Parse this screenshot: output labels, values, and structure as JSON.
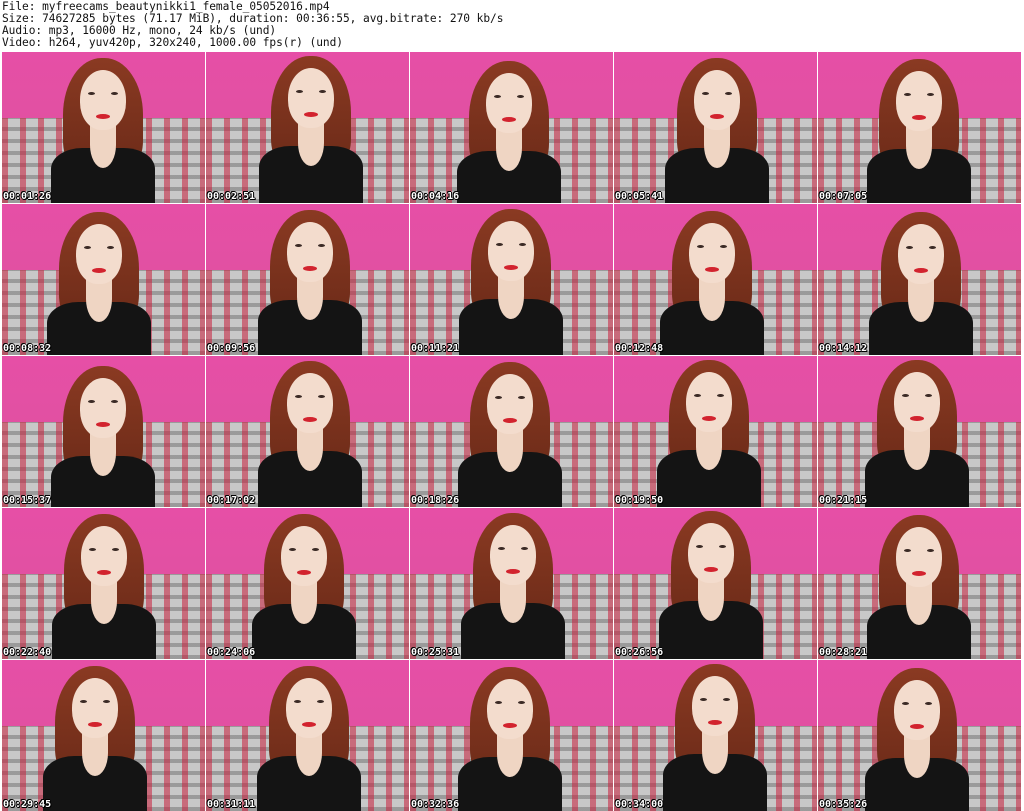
{
  "header": {
    "line1": "File: myfreecams_beautynikki1_female_05052016.mp4",
    "line2": "Size: 74627285 bytes (71.17 MiB), duration: 00:36:55, avg.bitrate: 270 kb/s",
    "line3": "Audio: mp3, 16000 Hz, mono, 24 kb/s (und)",
    "line4": "Video: h264, yuv420p, 320x240, 1000.00 fps(r) (und)"
  },
  "thumbnails": [
    {
      "timestamp": "00:01:26"
    },
    {
      "timestamp": "00:02:51"
    },
    {
      "timestamp": "00:04:16"
    },
    {
      "timestamp": "00:05:41"
    },
    {
      "timestamp": "00:07:05"
    },
    {
      "timestamp": "00:08:32"
    },
    {
      "timestamp": "00:09:56"
    },
    {
      "timestamp": "00:11:21"
    },
    {
      "timestamp": "00:12:48"
    },
    {
      "timestamp": "00:14:12"
    },
    {
      "timestamp": "00:15:37"
    },
    {
      "timestamp": "00:17:02"
    },
    {
      "timestamp": "00:18:26"
    },
    {
      "timestamp": "00:19:50"
    },
    {
      "timestamp": "00:21:15"
    },
    {
      "timestamp": "00:22:40"
    },
    {
      "timestamp": "00:24:06"
    },
    {
      "timestamp": "00:25:31"
    },
    {
      "timestamp": "00:26:56"
    },
    {
      "timestamp": "00:28:21"
    },
    {
      "timestamp": "00:29:45"
    },
    {
      "timestamp": "00:31:11"
    },
    {
      "timestamp": "00:32:36"
    },
    {
      "timestamp": "00:34:00"
    },
    {
      "timestamp": "00:35:26"
    }
  ],
  "colors": {
    "wall": "#e64fa6",
    "hair": "#8a3a22",
    "skin": "#f3dccd",
    "top": "#141414",
    "lips": "#d2232e",
    "timestamp_text": "#ffffff"
  }
}
